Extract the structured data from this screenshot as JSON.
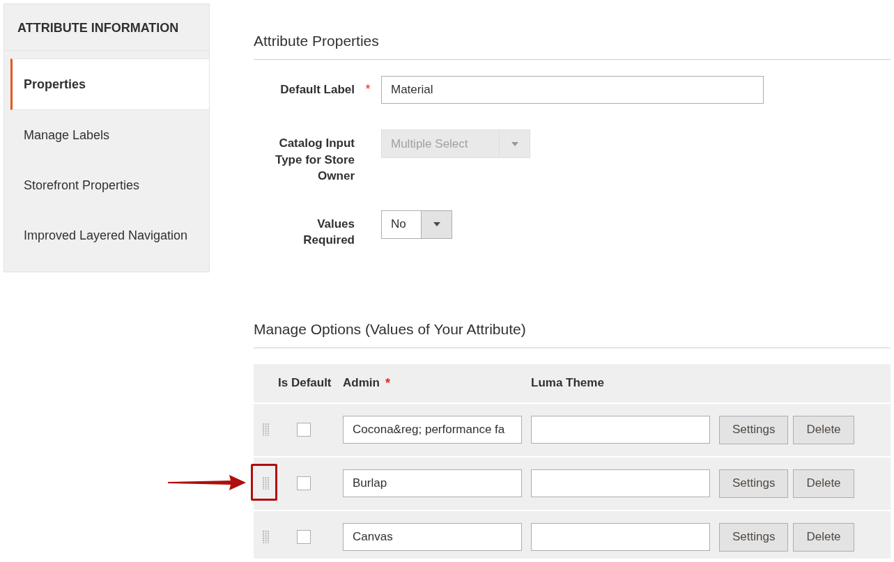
{
  "sidebar": {
    "title": "ATTRIBUTE INFORMATION",
    "items": [
      {
        "label": "Properties",
        "selected": true
      },
      {
        "label": "Manage Labels",
        "selected": false
      },
      {
        "label": "Storefront Properties",
        "selected": false
      },
      {
        "label": "Improved Layered Navigation",
        "selected": false
      }
    ]
  },
  "properties": {
    "title": "Attribute Properties",
    "fields": [
      {
        "kind": "text",
        "label": "Default Label",
        "required_mark": "*",
        "value": "Material"
      },
      {
        "kind": "select",
        "label": "Catalog Input Type for Store Owner",
        "value": "Multiple Select",
        "disabled": true
      },
      {
        "kind": "select",
        "label": "Values Required",
        "value": "No",
        "disabled": false
      }
    ]
  },
  "options": {
    "title": "Manage Options (Values of Your Attribute)",
    "columns": [
      {
        "label": "Is Default"
      },
      {
        "label": "Admin",
        "required_mark": "*"
      },
      {
        "label": "Luma Theme"
      }
    ],
    "rows": [
      {
        "checked": false,
        "admin": "Cocona&reg; performance fa",
        "luma": "",
        "annotated": false,
        "buttons": [
          "Settings",
          "Delete"
        ]
      },
      {
        "checked": false,
        "admin": "Burlap",
        "luma": "",
        "annotated": true,
        "buttons": [
          "Settings",
          "Delete"
        ]
      },
      {
        "checked": false,
        "admin": "Canvas",
        "luma": "",
        "annotated": false,
        "buttons": [
          "Settings",
          "Delete"
        ]
      }
    ]
  }
}
